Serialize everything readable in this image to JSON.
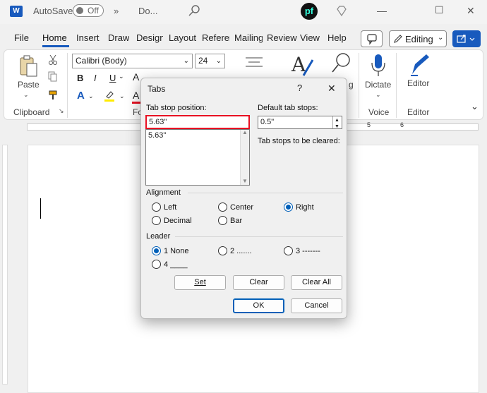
{
  "titlebar": {
    "autosave_label": "AutoSave",
    "autosave_state": "Off",
    "overflow_glyph": "»",
    "doc_title": "Do...",
    "brand_text": "pf",
    "window_controls": [
      "—",
      "☐",
      "✕"
    ]
  },
  "tabs": [
    "File",
    "Home",
    "Insert",
    "Draw",
    "Design",
    "Layout",
    "References",
    "Mailings",
    "Review",
    "View",
    "Help"
  ],
  "ribbon": {
    "comment_icon": "comment-icon",
    "editing_label": "Editing",
    "paste_label": "Paste",
    "clipboard_label": "Clipboard",
    "font_name": "Calibri (Body)",
    "font_size": "24",
    "bold": "B",
    "italic": "I",
    "underline": "U",
    "font_group_label": "Fo",
    "dictate_label": "Dictate",
    "voice_label": "Voice",
    "editor_label": "Editor",
    "editor_group_label": "Editor",
    "styles_partial": "g"
  },
  "ruler": {
    "marks": [
      "5",
      "6"
    ]
  },
  "dialog": {
    "title": "Tabs",
    "help_glyph": "?",
    "close_glyph": "✕",
    "tab_stop_position_label": "Tab stop position:",
    "tab_stop_position_value": "5.63\"",
    "tab_stop_list": [
      "5.63\""
    ],
    "default_tab_stops_label": "Default tab stops:",
    "default_tab_stops_value": "0.5\"",
    "to_be_cleared_label": "Tab stops to be cleared:",
    "alignment_label": "Alignment",
    "alignment_options": [
      "Left",
      "Center",
      "Right",
      "Decimal",
      "Bar"
    ],
    "alignment_selected": "Right",
    "leader_label": "Leader",
    "leader_options": [
      "1 None",
      "2 .......",
      "3 -------",
      "4 ____"
    ],
    "leader_selected": "1 None",
    "set_button": "Set",
    "clear_button": "Clear",
    "clear_all_button": "Clear All",
    "ok_button": "OK",
    "cancel_button": "Cancel"
  },
  "colors": {
    "accent": "#185abd",
    "highlight_box": "#e81123",
    "dialog_bg": "#f0f0f0"
  }
}
